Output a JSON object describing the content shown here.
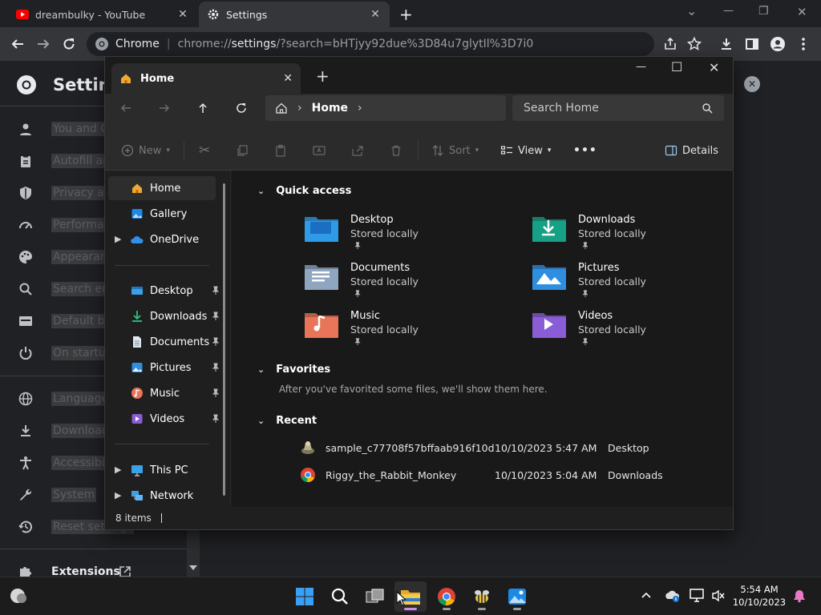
{
  "chrome": {
    "tabs": [
      {
        "title": "dreambulky - YouTube",
        "close": "✕"
      },
      {
        "title": "Settings",
        "close": "✕"
      }
    ],
    "new_tab": "+",
    "omnibox": {
      "site_label": "Chrome",
      "separator": "|",
      "url_scheme": "chrome://",
      "url_host": "settings",
      "url_rest": "/?search=bHTjyy92due%3D84u7glytIl%3D7i0"
    },
    "window_controls": {
      "dropdown": "⌄",
      "minimize": "—",
      "restore": "❐",
      "close": "✕"
    }
  },
  "settings": {
    "title": "Settings",
    "menu": [
      {
        "label": "You and Google",
        "icon": "person-icon"
      },
      {
        "label": "Autofill and passwords",
        "icon": "clipboard-icon"
      },
      {
        "label": "Privacy and security",
        "icon": "shield-icon"
      },
      {
        "label": "Performance",
        "icon": "speedometer-icon"
      },
      {
        "label": "Appearance",
        "icon": "palette-icon"
      },
      {
        "label": "Search engine",
        "icon": "search-icon"
      },
      {
        "label": "Default browser",
        "icon": "browser-icon"
      },
      {
        "label": "On startup",
        "icon": "power-icon"
      },
      {
        "label": "Languages",
        "icon": "globe-icon"
      },
      {
        "label": "Downloads",
        "icon": "download-icon"
      },
      {
        "label": "Accessibility",
        "icon": "accessibility-icon"
      },
      {
        "label": "System",
        "icon": "wrench-icon"
      },
      {
        "label": "Reset settings",
        "icon": "history-icon"
      }
    ],
    "extensions": "Extensions",
    "search_clear": "✕"
  },
  "explorer": {
    "tab_title": "Home",
    "new_tab": "+",
    "window_controls": {
      "minimize": "—",
      "maximize": "☐",
      "close": "✕"
    },
    "address": {
      "crumb": "Home",
      "sep": "›"
    },
    "search_placeholder": "Search Home",
    "commands": {
      "new": "New",
      "sort": "Sort",
      "view": "View",
      "more": "•••",
      "details": "Details"
    },
    "nav": {
      "top": [
        {
          "label": "Home"
        },
        {
          "label": "Gallery"
        },
        {
          "label": "OneDrive"
        }
      ],
      "pinned": [
        {
          "label": "Desktop"
        },
        {
          "label": "Downloads"
        },
        {
          "label": "Documents"
        },
        {
          "label": "Pictures"
        },
        {
          "label": "Music"
        },
        {
          "label": "Videos"
        }
      ],
      "bottom": [
        {
          "label": "This PC"
        },
        {
          "label": "Network"
        }
      ]
    },
    "sections": {
      "quick_access": "Quick access",
      "favorites": "Favorites",
      "recent": "Recent"
    },
    "quick_access": [
      {
        "name": "Desktop",
        "sub": "Stored locally",
        "color": "#2f9be6"
      },
      {
        "name": "Downloads",
        "sub": "Stored locally",
        "color": "#16a085"
      },
      {
        "name": "Documents",
        "sub": "Stored locally",
        "color": "#8fa5c0"
      },
      {
        "name": "Pictures",
        "sub": "Stored locally",
        "color": "#2f8ee0"
      },
      {
        "name": "Music",
        "sub": "Stored locally",
        "color": "#e8745a"
      },
      {
        "name": "Videos",
        "sub": "Stored locally",
        "color": "#8a5cd6"
      }
    ],
    "favorites_empty": "After you've favorited some files, we'll show them here.",
    "recent": [
      {
        "name": "sample_c77708f57bffaab916f10d...",
        "date": "10/10/2023 5:47 AM",
        "location": "Desktop"
      },
      {
        "name": "Riggy_the_Rabbit_Monkey",
        "date": "10/10/2023 5:04 AM",
        "location": "Downloads"
      }
    ],
    "status": "8 items"
  },
  "taskbar": {
    "time": "5:54 AM",
    "date": "10/10/2023"
  }
}
